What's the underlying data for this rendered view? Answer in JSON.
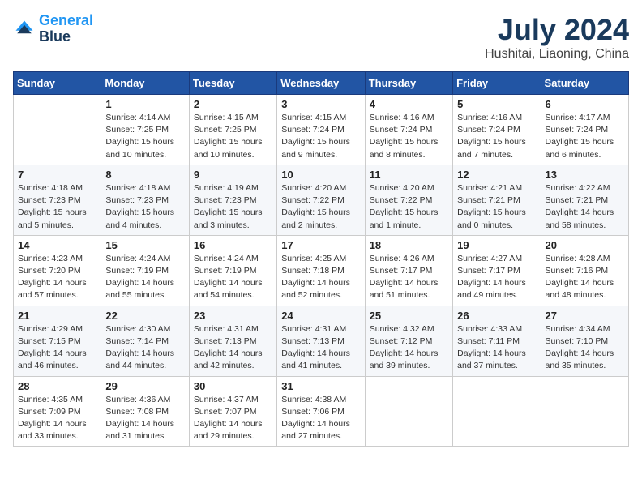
{
  "logo": {
    "line1": "General",
    "line2": "Blue"
  },
  "title": "July 2024",
  "location": "Hushitai, Liaoning, China",
  "days_of_week": [
    "Sunday",
    "Monday",
    "Tuesday",
    "Wednesday",
    "Thursday",
    "Friday",
    "Saturday"
  ],
  "weeks": [
    [
      {
        "date": "",
        "info": []
      },
      {
        "date": "1",
        "info": [
          "Sunrise: 4:14 AM",
          "Sunset: 7:25 PM",
          "Daylight: 15 hours",
          "and 10 minutes."
        ]
      },
      {
        "date": "2",
        "info": [
          "Sunrise: 4:15 AM",
          "Sunset: 7:25 PM",
          "Daylight: 15 hours",
          "and 10 minutes."
        ]
      },
      {
        "date": "3",
        "info": [
          "Sunrise: 4:15 AM",
          "Sunset: 7:24 PM",
          "Daylight: 15 hours",
          "and 9 minutes."
        ]
      },
      {
        "date": "4",
        "info": [
          "Sunrise: 4:16 AM",
          "Sunset: 7:24 PM",
          "Daylight: 15 hours",
          "and 8 minutes."
        ]
      },
      {
        "date": "5",
        "info": [
          "Sunrise: 4:16 AM",
          "Sunset: 7:24 PM",
          "Daylight: 15 hours",
          "and 7 minutes."
        ]
      },
      {
        "date": "6",
        "info": [
          "Sunrise: 4:17 AM",
          "Sunset: 7:24 PM",
          "Daylight: 15 hours",
          "and 6 minutes."
        ]
      }
    ],
    [
      {
        "date": "7",
        "info": [
          "Sunrise: 4:18 AM",
          "Sunset: 7:23 PM",
          "Daylight: 15 hours",
          "and 5 minutes."
        ]
      },
      {
        "date": "8",
        "info": [
          "Sunrise: 4:18 AM",
          "Sunset: 7:23 PM",
          "Daylight: 15 hours",
          "and 4 minutes."
        ]
      },
      {
        "date": "9",
        "info": [
          "Sunrise: 4:19 AM",
          "Sunset: 7:23 PM",
          "Daylight: 15 hours",
          "and 3 minutes."
        ]
      },
      {
        "date": "10",
        "info": [
          "Sunrise: 4:20 AM",
          "Sunset: 7:22 PM",
          "Daylight: 15 hours",
          "and 2 minutes."
        ]
      },
      {
        "date": "11",
        "info": [
          "Sunrise: 4:20 AM",
          "Sunset: 7:22 PM",
          "Daylight: 15 hours",
          "and 1 minute."
        ]
      },
      {
        "date": "12",
        "info": [
          "Sunrise: 4:21 AM",
          "Sunset: 7:21 PM",
          "Daylight: 15 hours",
          "and 0 minutes."
        ]
      },
      {
        "date": "13",
        "info": [
          "Sunrise: 4:22 AM",
          "Sunset: 7:21 PM",
          "Daylight: 14 hours",
          "and 58 minutes."
        ]
      }
    ],
    [
      {
        "date": "14",
        "info": [
          "Sunrise: 4:23 AM",
          "Sunset: 7:20 PM",
          "Daylight: 14 hours",
          "and 57 minutes."
        ]
      },
      {
        "date": "15",
        "info": [
          "Sunrise: 4:24 AM",
          "Sunset: 7:19 PM",
          "Daylight: 14 hours",
          "and 55 minutes."
        ]
      },
      {
        "date": "16",
        "info": [
          "Sunrise: 4:24 AM",
          "Sunset: 7:19 PM",
          "Daylight: 14 hours",
          "and 54 minutes."
        ]
      },
      {
        "date": "17",
        "info": [
          "Sunrise: 4:25 AM",
          "Sunset: 7:18 PM",
          "Daylight: 14 hours",
          "and 52 minutes."
        ]
      },
      {
        "date": "18",
        "info": [
          "Sunrise: 4:26 AM",
          "Sunset: 7:17 PM",
          "Daylight: 14 hours",
          "and 51 minutes."
        ]
      },
      {
        "date": "19",
        "info": [
          "Sunrise: 4:27 AM",
          "Sunset: 7:17 PM",
          "Daylight: 14 hours",
          "and 49 minutes."
        ]
      },
      {
        "date": "20",
        "info": [
          "Sunrise: 4:28 AM",
          "Sunset: 7:16 PM",
          "Daylight: 14 hours",
          "and 48 minutes."
        ]
      }
    ],
    [
      {
        "date": "21",
        "info": [
          "Sunrise: 4:29 AM",
          "Sunset: 7:15 PM",
          "Daylight: 14 hours",
          "and 46 minutes."
        ]
      },
      {
        "date": "22",
        "info": [
          "Sunrise: 4:30 AM",
          "Sunset: 7:14 PM",
          "Daylight: 14 hours",
          "and 44 minutes."
        ]
      },
      {
        "date": "23",
        "info": [
          "Sunrise: 4:31 AM",
          "Sunset: 7:13 PM",
          "Daylight: 14 hours",
          "and 42 minutes."
        ]
      },
      {
        "date": "24",
        "info": [
          "Sunrise: 4:31 AM",
          "Sunset: 7:13 PM",
          "Daylight: 14 hours",
          "and 41 minutes."
        ]
      },
      {
        "date": "25",
        "info": [
          "Sunrise: 4:32 AM",
          "Sunset: 7:12 PM",
          "Daylight: 14 hours",
          "and 39 minutes."
        ]
      },
      {
        "date": "26",
        "info": [
          "Sunrise: 4:33 AM",
          "Sunset: 7:11 PM",
          "Daylight: 14 hours",
          "and 37 minutes."
        ]
      },
      {
        "date": "27",
        "info": [
          "Sunrise: 4:34 AM",
          "Sunset: 7:10 PM",
          "Daylight: 14 hours",
          "and 35 minutes."
        ]
      }
    ],
    [
      {
        "date": "28",
        "info": [
          "Sunrise: 4:35 AM",
          "Sunset: 7:09 PM",
          "Daylight: 14 hours",
          "and 33 minutes."
        ]
      },
      {
        "date": "29",
        "info": [
          "Sunrise: 4:36 AM",
          "Sunset: 7:08 PM",
          "Daylight: 14 hours",
          "and 31 minutes."
        ]
      },
      {
        "date": "30",
        "info": [
          "Sunrise: 4:37 AM",
          "Sunset: 7:07 PM",
          "Daylight: 14 hours",
          "and 29 minutes."
        ]
      },
      {
        "date": "31",
        "info": [
          "Sunrise: 4:38 AM",
          "Sunset: 7:06 PM",
          "Daylight: 14 hours",
          "and 27 minutes."
        ]
      },
      {
        "date": "",
        "info": []
      },
      {
        "date": "",
        "info": []
      },
      {
        "date": "",
        "info": []
      }
    ]
  ]
}
